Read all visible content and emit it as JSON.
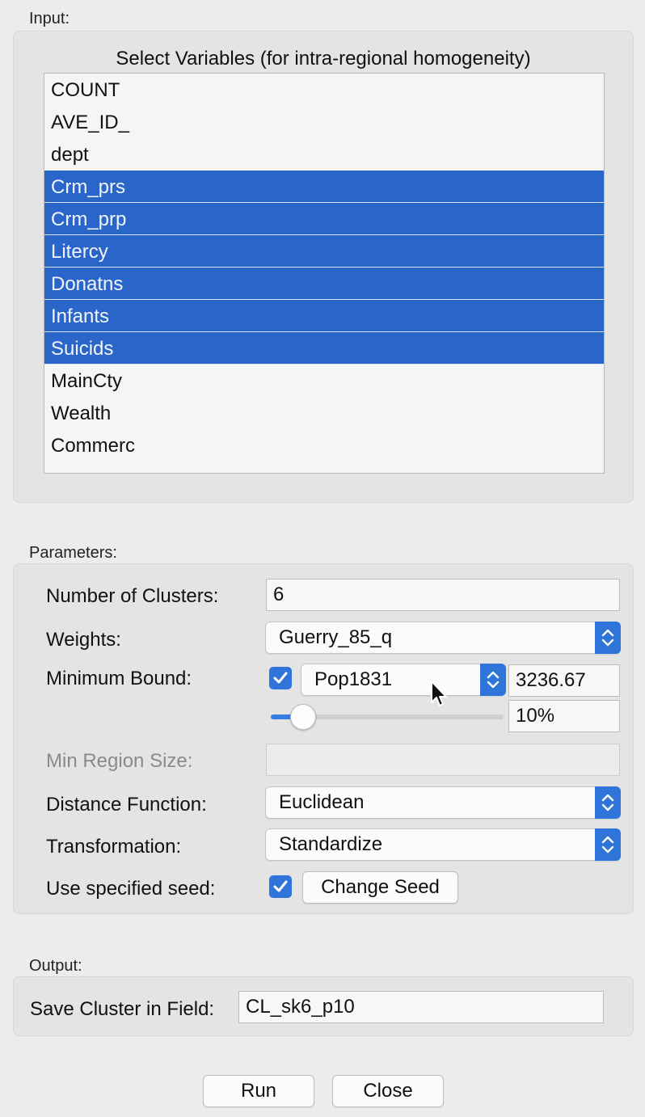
{
  "input": {
    "section_label": "Input:",
    "list_title": "Select Variables (for intra-regional homogeneity)",
    "variables": [
      {
        "name": "COUNT",
        "selected": false
      },
      {
        "name": "AVE_ID_",
        "selected": false
      },
      {
        "name": "dept",
        "selected": false
      },
      {
        "name": "Crm_prs",
        "selected": true
      },
      {
        "name": "Crm_prp",
        "selected": true
      },
      {
        "name": "Litercy",
        "selected": true
      },
      {
        "name": "Donatns",
        "selected": true
      },
      {
        "name": "Infants",
        "selected": true
      },
      {
        "name": "Suicids",
        "selected": true
      },
      {
        "name": "MainCty",
        "selected": false
      },
      {
        "name": "Wealth",
        "selected": false
      },
      {
        "name": "Commerc",
        "selected": false
      }
    ]
  },
  "parameters": {
    "section_label": "Parameters:",
    "num_clusters_label": "Number of Clusters:",
    "num_clusters_value": "6",
    "weights_label": "Weights:",
    "weights_value": "Guerry_85_q",
    "min_bound_label": "Minimum Bound:",
    "min_bound_checked": true,
    "min_bound_variable": "Pop1831",
    "min_bound_value": "3236.67",
    "min_bound_percent": "10%",
    "min_bound_slider_fraction": 0.1,
    "min_region_label": "Min Region Size:",
    "min_region_value": "",
    "distance_label": "Distance Function:",
    "distance_value": "Euclidean",
    "transformation_label": "Transformation:",
    "transformation_value": "Standardize",
    "seed_label": "Use specified seed:",
    "seed_checked": true,
    "change_seed_label": "Change Seed"
  },
  "output": {
    "section_label": "Output:",
    "save_field_label": "Save Cluster in Field:",
    "save_field_value": "CL_sk6_p10"
  },
  "buttons": {
    "run_label": "Run",
    "close_label": "Close"
  },
  "colors": {
    "selection": "#2a66c9",
    "accent": "#2f74d9"
  }
}
